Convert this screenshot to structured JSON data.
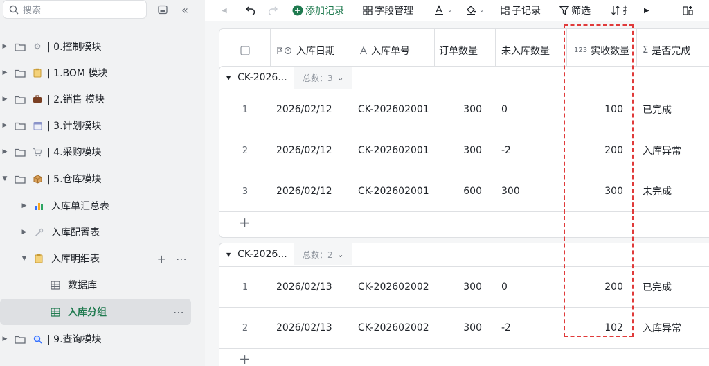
{
  "sidebar": {
    "search_placeholder": "搜索",
    "items": [
      {
        "label": "| 0.控制模块",
        "emoji": "⚙",
        "emoji_color": "#8f959e",
        "arrow": "▶"
      },
      {
        "label": "| 1.BOM 模块",
        "emoji": "📋",
        "emoji_color": "#d9a441",
        "arrow": "▶"
      },
      {
        "label": "| 2.销售 模块",
        "emoji": "💼",
        "emoji_color": "#8a4b2a",
        "arrow": "▶"
      },
      {
        "label": "| 3.计划模块",
        "emoji": "📅",
        "emoji_color": "#5b6cc9",
        "arrow": "▶"
      },
      {
        "label": "| 4.采购模块",
        "emoji": "🛒",
        "emoji_color": "#8f959e",
        "arrow": "▶"
      },
      {
        "label": "| 5.仓库模块",
        "emoji": "📦",
        "emoji_color": "#c78b3c",
        "arrow": "▼"
      },
      {
        "label": "| 9.查询模块",
        "emoji": "🔍",
        "emoji_color": "#3370ff",
        "arrow": "▶"
      }
    ],
    "children": [
      {
        "label": "入库单汇总表",
        "icon": "bar-chart-icon",
        "arrow": "▶"
      },
      {
        "label": "入库配置表",
        "icon": "wrench-icon",
        "arrow": "▶"
      },
      {
        "label": "入库明细表",
        "icon": "clipboard-icon",
        "arrow": "▼"
      }
    ],
    "grandchildren": [
      {
        "label": "数据库",
        "icon": "table-icon"
      },
      {
        "label": "入库分组",
        "icon": "table-icon"
      }
    ]
  },
  "toolbar": {
    "add_record": "添加记录",
    "field_manage": "字段管理",
    "sub_record": "子记录",
    "filter": "筛选",
    "sort_partial": "扌"
  },
  "columns": [
    {
      "label": "",
      "icon": "checkbox-icon"
    },
    {
      "label": "入库日期",
      "icon": "date-flag-icon"
    },
    {
      "label": "入库单号",
      "icon": "text-icon"
    },
    {
      "label": "订单数量",
      "icon": ""
    },
    {
      "label": "未入库数量",
      "icon": ""
    },
    {
      "label": "实收数量",
      "icon": "number-icon",
      "icon_text": "123"
    },
    {
      "label": "是否完成",
      "icon": "formula-icon",
      "icon_text": "Σ"
    }
  ],
  "groups": [
    {
      "title": "CK-2026...",
      "count_label": "总数：3",
      "rows": [
        {
          "idx": "1",
          "date": "2026/02/12",
          "order_no": "CK-202602001",
          "order_qty": "300",
          "pending_qty": "0",
          "received_qty": "100",
          "status": "已完成"
        },
        {
          "idx": "2",
          "date": "2026/02/12",
          "order_no": "CK-202602001",
          "order_qty": "300",
          "pending_qty": "-2",
          "received_qty": "200",
          "status": "入库异常"
        },
        {
          "idx": "3",
          "date": "2026/02/12",
          "order_no": "CK-202602001",
          "order_qty": "600",
          "pending_qty": "300",
          "received_qty": "300",
          "status": "未完成"
        }
      ]
    },
    {
      "title": "CK-2026...",
      "count_label": "总数：2",
      "rows": [
        {
          "idx": "1",
          "date": "2026/02/13",
          "order_no": "CK-202602002",
          "order_qty": "300",
          "pending_qty": "0",
          "received_qty": "200",
          "status": "已完成"
        },
        {
          "idx": "2",
          "date": "2026/02/13",
          "order_no": "CK-202602002",
          "order_qty": "300",
          "pending_qty": "-2",
          "received_qty": "102",
          "status": "入库异常"
        }
      ]
    }
  ],
  "colors": {
    "accent_green": "#1f7a4f",
    "highlight_red": "#e03a3a"
  }
}
